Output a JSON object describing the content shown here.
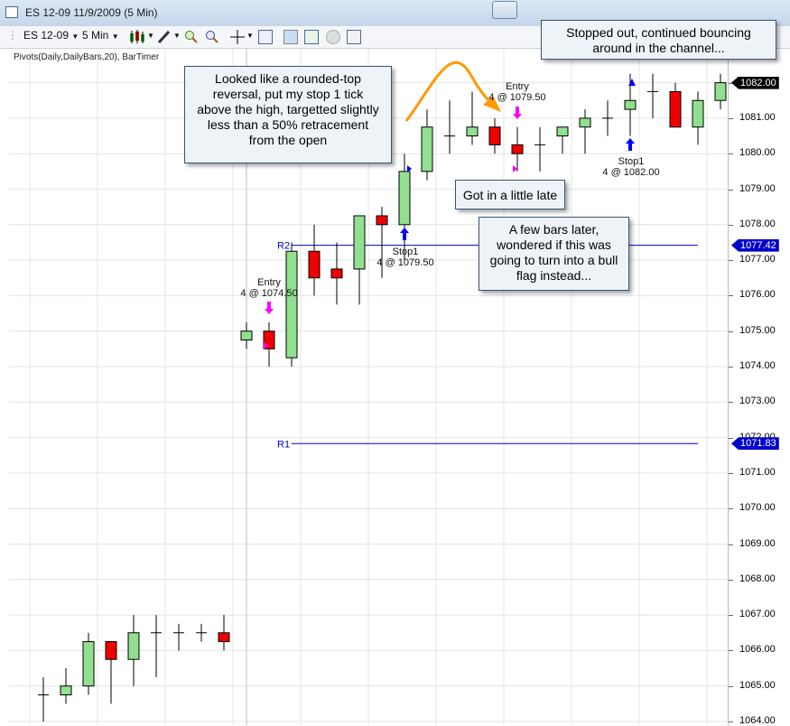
{
  "window": {
    "title": "ES 12-09  11/9/2009 (5 Min)"
  },
  "toolbar": {
    "instrument": "ES 12-09",
    "interval": "5 Min"
  },
  "indicator_label": "Pivots(Daily,DailyBars,20), BarTimer",
  "callouts": {
    "reversal": [
      "Looked like a rounded-top",
      "reversal, put my stop 1 tick",
      "above the high, targetted slightly",
      "less than a 50% retracement",
      "from the open"
    ],
    "stopped": [
      "Stopped out, continued bouncing",
      "around in the channel..."
    ],
    "late": [
      "Got in a little late"
    ],
    "bullflag": [
      "A few bars later,",
      "wondered if this was",
      "going to turn into a bull",
      "flag instead..."
    ]
  },
  "annotations": {
    "entry1": [
      "Entry",
      "4 @ 1074.50"
    ],
    "stop1": [
      "Stop1",
      "4 @ 1079.50"
    ],
    "entry2": [
      "Entry",
      "4 @ 1079.50"
    ],
    "stop2": [
      "Stop1",
      "4 @ 1082.00"
    ]
  },
  "pivots": {
    "R2": {
      "label": "R2",
      "value": 1077.42,
      "flag": "1077.42"
    },
    "R1": {
      "label": "R1",
      "value": 1071.83,
      "flag": "1071.83"
    }
  },
  "last_price_flag": "1082.00",
  "colors": {
    "up": "#90e090",
    "down": "#ee0000",
    "pivot": "#0000cc",
    "entry_arrow": "#ff00ff",
    "stop_arrow": "#0000ff",
    "curve_arrow": "#ff9a00"
  },
  "chart_data": {
    "type": "candlestick",
    "y_ticks": [
      "1082.00",
      "1081.00",
      "1080.00",
      "1079.00",
      "1078.00",
      "1077.00",
      "1076.00",
      "1075.00",
      "1074.00",
      "1073.00",
      "1072.00",
      "1071.00",
      "1070.00",
      "1069.00",
      "1068.00",
      "1067.00",
      "1066.00",
      "1065.00",
      "1064.00"
    ],
    "ylim": [
      1064.0,
      1083.0
    ],
    "candles": [
      {
        "i": 0,
        "o": 1064.75,
        "h": 1065.25,
        "l": 1064.0,
        "c": 1064.75
      },
      {
        "i": 1,
        "o": 1064.75,
        "h": 1065.5,
        "l": 1064.5,
        "c": 1065.0
      },
      {
        "i": 2,
        "o": 1065.0,
        "h": 1066.5,
        "l": 1064.75,
        "c": 1066.25
      },
      {
        "i": 3,
        "o": 1066.25,
        "h": 1066.25,
        "l": 1064.5,
        "c": 1065.75
      },
      {
        "i": 4,
        "o": 1065.75,
        "h": 1067.0,
        "l": 1065.0,
        "c": 1066.5
      },
      {
        "i": 5,
        "o": 1066.5,
        "h": 1067.0,
        "l": 1065.25,
        "c": 1066.5
      },
      {
        "i": 6,
        "o": 1066.5,
        "h": 1066.75,
        "l": 1066.0,
        "c": 1066.5
      },
      {
        "i": 7,
        "o": 1066.5,
        "h": 1066.75,
        "l": 1066.25,
        "c": 1066.5
      },
      {
        "i": 8,
        "o": 1066.5,
        "h": 1067.0,
        "l": 1066.0,
        "c": 1066.25
      },
      {
        "i": 9,
        "o": 1074.75,
        "h": 1075.25,
        "l": 1074.5,
        "c": 1075.0
      },
      {
        "i": 10,
        "o": 1075.0,
        "h": 1075.25,
        "l": 1074.0,
        "c": 1074.5
      },
      {
        "i": 11,
        "o": 1074.25,
        "h": 1077.5,
        "l": 1074.0,
        "c": 1077.25
      },
      {
        "i": 12,
        "o": 1077.25,
        "h": 1078.0,
        "l": 1076.0,
        "c": 1076.5
      },
      {
        "i": 13,
        "o": 1076.75,
        "h": 1077.5,
        "l": 1075.75,
        "c": 1076.5
      },
      {
        "i": 14,
        "o": 1076.75,
        "h": 1078.25,
        "l": 1075.75,
        "c": 1078.25
      },
      {
        "i": 15,
        "o": 1078.25,
        "h": 1078.5,
        "l": 1076.5,
        "c": 1078.0
      },
      {
        "i": 16,
        "o": 1078.0,
        "h": 1080.0,
        "l": 1077.0,
        "c": 1079.5
      },
      {
        "i": 17,
        "o": 1079.5,
        "h": 1081.25,
        "l": 1079.25,
        "c": 1080.75
      },
      {
        "i": 18,
        "o": 1080.5,
        "h": 1081.5,
        "l": 1080.0,
        "c": 1080.5
      },
      {
        "i": 19,
        "o": 1080.5,
        "h": 1081.75,
        "l": 1080.25,
        "c": 1080.75
      },
      {
        "i": 20,
        "o": 1080.75,
        "h": 1081.0,
        "l": 1080.0,
        "c": 1080.25
      },
      {
        "i": 21,
        "o": 1080.25,
        "h": 1080.75,
        "l": 1079.5,
        "c": 1080.0
      },
      {
        "i": 22,
        "o": 1080.25,
        "h": 1080.75,
        "l": 1079.5,
        "c": 1080.25
      },
      {
        "i": 23,
        "o": 1080.5,
        "h": 1080.75,
        "l": 1080.0,
        "c": 1080.75
      },
      {
        "i": 24,
        "o": 1080.75,
        "h": 1081.25,
        "l": 1080.0,
        "c": 1081.0
      },
      {
        "i": 25,
        "o": 1081.0,
        "h": 1081.5,
        "l": 1080.5,
        "c": 1081.0
      },
      {
        "i": 26,
        "o": 1081.25,
        "h": 1082.25,
        "l": 1080.5,
        "c": 1081.5
      },
      {
        "i": 27,
        "o": 1081.75,
        "h": 1082.25,
        "l": 1081.0,
        "c": 1081.75
      },
      {
        "i": 28,
        "o": 1081.75,
        "h": 1082.0,
        "l": 1080.75,
        "c": 1080.75
      },
      {
        "i": 29,
        "o": 1080.75,
        "h": 1081.75,
        "l": 1080.25,
        "c": 1081.5
      },
      {
        "i": 30,
        "o": 1081.5,
        "h": 1082.25,
        "l": 1081.25,
        "c": 1082.0
      }
    ]
  }
}
